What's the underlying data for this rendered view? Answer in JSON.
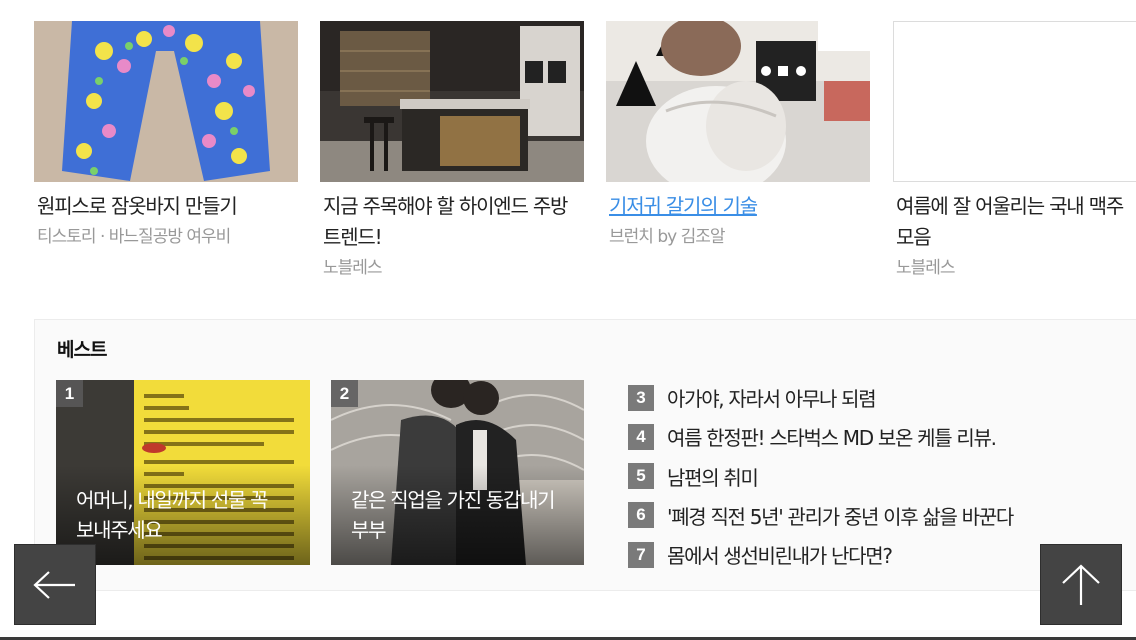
{
  "cards": [
    {
      "title": "원피스로 잠옷바지 만들기",
      "meta": "티스토리 · 바느질공방 여우비",
      "image": "floral-pajama-pants-photo"
    },
    {
      "title": "지금 주목해야 할 하이엔드 주방 트렌드!",
      "meta": "노블레스",
      "image": "luxury-kitchen-photo"
    },
    {
      "title": "기저귀 갈기의 기술",
      "meta": "브런치 by 김조알",
      "image": "baby-diaper-photo"
    },
    {
      "title": "여름에 잘 어울리는 국내 맥주 모음",
      "meta": "노블레스",
      "image": "blank-thumbnail"
    }
  ],
  "best": {
    "heading": "베스트",
    "featured": [
      {
        "rank": "1",
        "caption": "어머니, 내일까지 선물 꼭 보내주세요",
        "image": "school-notice-photo"
      },
      {
        "rank": "2",
        "caption": "같은 직업을 가진 동갑내기 부부",
        "image": "couple-photo"
      }
    ],
    "list": [
      {
        "rank": "3",
        "text": "아가야, 자라서 아무나 되렴"
      },
      {
        "rank": "4",
        "text": "여름 한정판! 스타벅스 MD 보온 케틀 리뷰."
      },
      {
        "rank": "5",
        "text": "남편의 취미"
      },
      {
        "rank": "6",
        "text": "'폐경 직전 5년' 관리가 중년 이후 삶을 바꾼다"
      },
      {
        "rank": "7",
        "text": "몸에서 생선비린내가 난다면?"
      }
    ]
  },
  "nav": {
    "back_icon": "arrow-left-icon",
    "top_icon": "arrow-up-icon"
  },
  "colors": {
    "link": "#3a8ee6",
    "meta": "#999999",
    "rank_badge": "#7a7a7a",
    "fab": "#444444"
  }
}
